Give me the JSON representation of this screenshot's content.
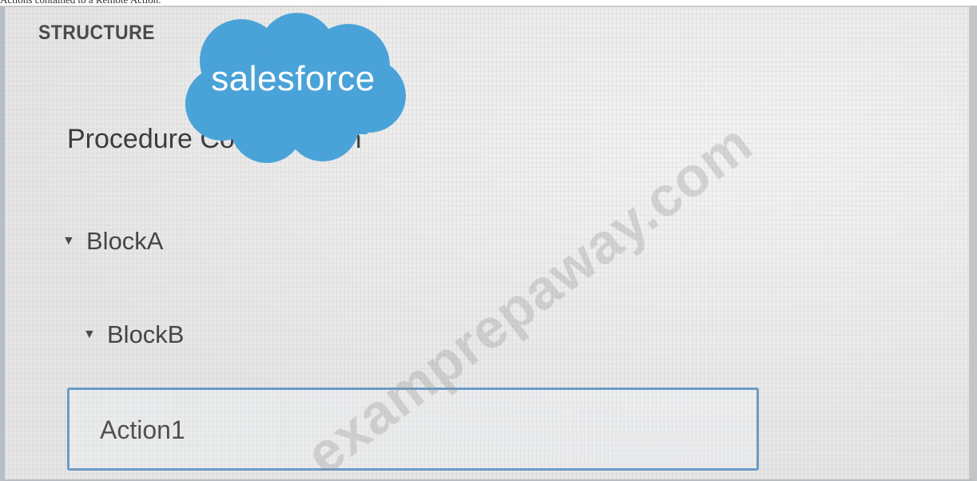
{
  "caption": "Actions contained to a Remote Action.",
  "structure": {
    "title": "STRUCTURE",
    "procedure_label": "Procedure Configuration",
    "tree": [
      {
        "label": "BlockA",
        "expanded": true
      },
      {
        "label": "BlockB",
        "expanded": true
      }
    ],
    "selected_action": "Action1"
  },
  "logo": {
    "text": "salesforce",
    "color": "#4aa3d8"
  },
  "watermark": "examprepaway.com",
  "colors": {
    "selection_border": "#6b9bc6",
    "background": "#e9eae9"
  }
}
